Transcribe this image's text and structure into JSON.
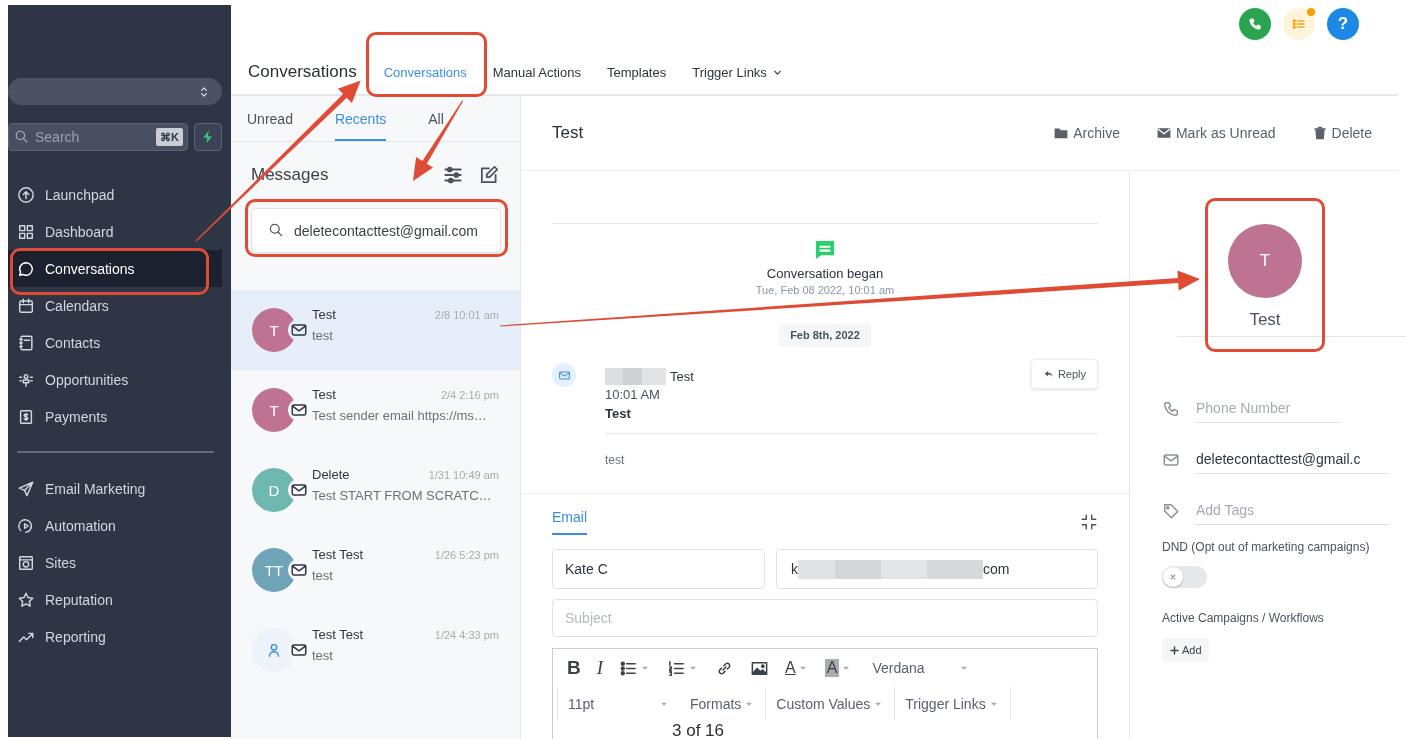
{
  "sidebar": {
    "search": {
      "placeholder": "Search",
      "shortcut": "⌘K"
    },
    "nav_groups": [
      [
        {
          "kind": "launchpad",
          "label": "Launchpad",
          "selected": false,
          "highlighted": false
        },
        {
          "kind": "dashboard",
          "label": "Dashboard",
          "selected": false,
          "highlighted": false
        },
        {
          "kind": "chat",
          "label": "Conversations",
          "selected": true,
          "highlighted": true
        },
        {
          "kind": "calendar",
          "label": "Calendars",
          "selected": false,
          "highlighted": false
        },
        {
          "kind": "contacts",
          "label": "Contacts",
          "selected": false,
          "highlighted": false
        },
        {
          "kind": "opportunities",
          "label": "Opportunities",
          "selected": false,
          "highlighted": false
        },
        {
          "kind": "payments",
          "label": "Payments",
          "selected": false,
          "highlighted": false
        }
      ],
      [
        {
          "kind": "send",
          "label": "Email Marketing",
          "selected": false,
          "highlighted": false
        },
        {
          "kind": "automation",
          "label": "Automation",
          "selected": false,
          "highlighted": false
        },
        {
          "kind": "sites",
          "label": "Sites",
          "selected": false,
          "highlighted": false
        },
        {
          "kind": "star",
          "label": "Reputation",
          "selected": false,
          "highlighted": false
        },
        {
          "kind": "reporting",
          "label": "Reporting",
          "selected": false,
          "highlighted": false
        }
      ]
    ]
  },
  "header": {
    "title": "Conversations",
    "tabs": [
      {
        "label": "Conversations",
        "selected": true,
        "highlighted": true,
        "dropdown": false
      },
      {
        "label": "Manual Actions",
        "selected": false,
        "highlighted": false,
        "dropdown": false
      },
      {
        "label": "Templates",
        "selected": false,
        "highlighted": false,
        "dropdown": false
      },
      {
        "label": "Trigger Links",
        "selected": false,
        "highlighted": false,
        "dropdown": true
      }
    ],
    "top_icons": [
      {
        "kind": "phone",
        "badge": false
      },
      {
        "kind": "tasks",
        "badge": true
      },
      {
        "kind": "help",
        "label": "?",
        "badge": false
      }
    ]
  },
  "conversation_list": {
    "filters": [
      {
        "label": "Unread",
        "selected": false
      },
      {
        "label": "Recents",
        "selected": true
      },
      {
        "label": "All",
        "selected": false
      }
    ],
    "heading": "Messages",
    "search": {
      "value": "deletecontacttest@gmail.com",
      "highlighted": true
    },
    "items": [
      {
        "kind": "initials",
        "initials": "T",
        "color": "#bd7391",
        "name": "Test",
        "time": "2/8 10:01 am",
        "preview": "test",
        "selected": true
      },
      {
        "kind": "initials",
        "initials": "T",
        "color": "#bd7391",
        "name": "Test",
        "time": "2/4 2:16 pm",
        "preview": "Test sender email https://ms…",
        "selected": false
      },
      {
        "kind": "initials",
        "initials": "D",
        "color": "#6fb8b1",
        "name": "Delete",
        "time": "1/31 10:49 am",
        "preview": "Test START FROM SCRATC…",
        "selected": false
      },
      {
        "kind": "initials",
        "initials": "TT",
        "color": "#6fa3b8",
        "name": "Test Test",
        "time": "1/26 5:23 pm",
        "preview": "test",
        "selected": false
      },
      {
        "kind": "person",
        "color": "#eef3fb",
        "name": "Test Test",
        "time": "1/24 4:33 pm",
        "preview": "test",
        "selected": false
      }
    ]
  },
  "conversation": {
    "title": "Test",
    "actions": [
      {
        "kind": "archive",
        "label": "Archive"
      },
      {
        "kind": "mail",
        "label": "Mark as Unread"
      },
      {
        "kind": "trash",
        "label": "Delete"
      }
    ],
    "event": {
      "title": "Conversation began",
      "time": "Tue, Feb 08 2022, 10:01 am"
    },
    "date_chip": "Feb 8th, 2022",
    "message": {
      "sender": "Test",
      "time": "10:01 AM",
      "subject": "Test",
      "body": "test",
      "reply": "Reply"
    }
  },
  "composer": {
    "tabs": [
      {
        "label": "Email",
        "selected": true
      }
    ],
    "from_name": "Kate C",
    "to_prefix": "k",
    "to_suffix": "com",
    "subject_placeholder": "Subject",
    "toolbar": [
      {
        "kind": "bold",
        "label": "B",
        "caret": false
      },
      {
        "kind": "italic",
        "label": "I",
        "caret": false
      },
      {
        "kind": "bullets",
        "caret": true
      },
      {
        "kind": "numbered",
        "caret": true
      },
      {
        "kind": "link",
        "caret": false
      },
      {
        "kind": "image",
        "caret": false
      },
      {
        "kind": "text-color",
        "label": "A",
        "caret": true
      },
      {
        "kind": "highlight-color",
        "label": "A",
        "caret": true
      },
      {
        "kind": "select",
        "label": "Verdana",
        "caret": true
      }
    ],
    "toolbar_row2": [
      {
        "label": "11pt"
      },
      {
        "label": "Formats"
      },
      {
        "label": "Custom Values"
      },
      {
        "label": "Trigger Links"
      }
    ]
  },
  "contact": {
    "initial": "T",
    "color": "#bd7391",
    "name": "Test",
    "highlighted": true,
    "fields": [
      {
        "kind": "phone",
        "placeholder": "Phone Number"
      },
      {
        "kind": "email",
        "value": "deletecontacttest@gmail.c"
      },
      {
        "kind": "tag",
        "placeholder": "Add Tags"
      }
    ],
    "dnd_label": "DND (Opt out of marketing campaigns)",
    "dnd_on": false,
    "campaigns_label": "Active Campaigns / Workflows",
    "add_button": "Add"
  },
  "page_indicator": "3 of 16"
}
